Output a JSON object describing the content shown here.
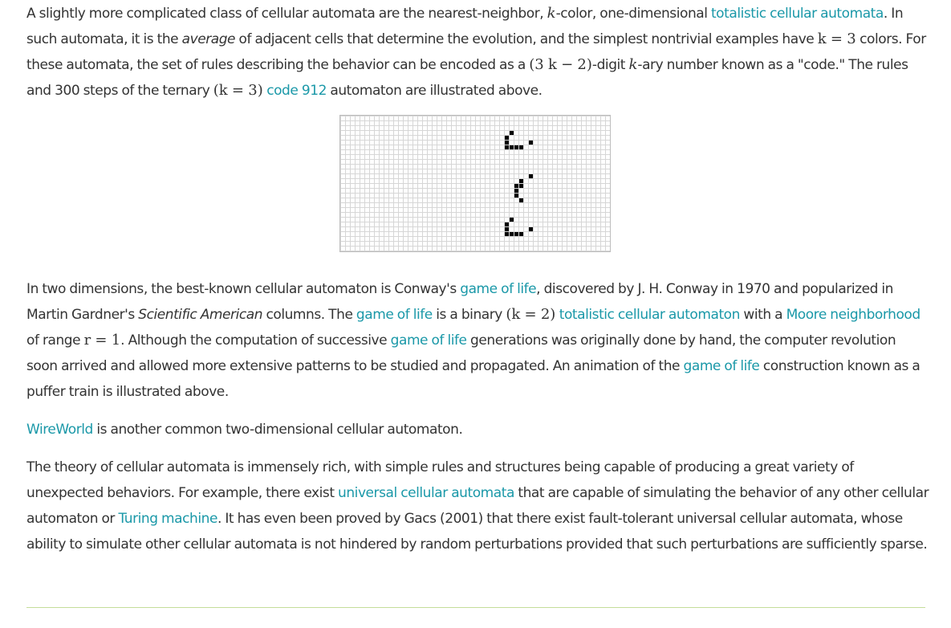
{
  "p1": {
    "t1": "A slightly more complicated class of cellular automata are the nearest-neighbor, ",
    "k1": "k",
    "t2": "-color, one-dimensional ",
    "link1": "totalistic cellular automata",
    "t3": ". In such automata, it is the ",
    "em1": "average",
    "t4": " of adjacent cells that determine the evolution, and the simplest nontrivial examples have ",
    "math1": "k = 3",
    "t5": " colors. For these automata, the set of rules describing the behavior can be encoded as a ",
    "math2": "(3 k − 2)",
    "t6": "-digit ",
    "k2": "k",
    "t7": "-ary number known as a \"code.\" The rules and 300 steps of the ternary ",
    "math3": "(k = 3)",
    "t8": " ",
    "link2": "code 912",
    "t9": " automaton are illustrated above."
  },
  "p2": {
    "t1": "In two dimensions, the best-known cellular automaton is Conway's ",
    "link1": "game of life",
    "t2": ", discovered by J. H. Conway in 1970 and popularized in Martin Gardner's ",
    "em1": "Scientific American",
    "t3": " columns. The ",
    "link2": "game of life",
    "t4": " is a binary ",
    "math1": "(k = 2)",
    "t5": " ",
    "link3": "totalistic cellular automaton",
    "t6": " with a ",
    "link4": "Moore neighborhood",
    "t7": " of range ",
    "math2": "r = 1",
    "t8": ". Although the computation of successive ",
    "link5": "game of life",
    "t9": " generations was originally done by hand, the computer revolution soon arrived and allowed more extensive patterns to be studied and propagated. An animation of the ",
    "link6": "game of life",
    "t10": " construction known as a puffer train is illustrated above."
  },
  "p3": {
    "link1": "WireWorld",
    "t1": " is another common two-dimensional cellular automaton."
  },
  "p4": {
    "t1": "The theory of cellular automata is immensely rich, with simple rules and structures being capable of producing a great variety of unexpected behaviors. For example, there exist ",
    "link1": "universal cellular automata",
    "t2": " that are capable of simulating the behavior of any other cellular automaton or ",
    "link2": "Turing machine",
    "t3": ". It has even been proved by Gacs (2001) that there exist fault-tolerant universal cellular automata, whose ability to simulate other cellular automata is not hindered by random perturbations provided that such perturbations are sufficiently sparse."
  },
  "figure": {
    "grid_cols": 56,
    "grid_rows": 28,
    "alive_color": "#000000",
    "alive_cells": [
      [
        35,
        3
      ],
      [
        34,
        4
      ],
      [
        34,
        5
      ],
      [
        34,
        6
      ],
      [
        35,
        6
      ],
      [
        36,
        6
      ],
      [
        37,
        6
      ],
      [
        39,
        5
      ],
      [
        39,
        12
      ],
      [
        37,
        13
      ],
      [
        36,
        14
      ],
      [
        37,
        14
      ],
      [
        36,
        15
      ],
      [
        36,
        16
      ],
      [
        37,
        17
      ],
      [
        35,
        21
      ],
      [
        34,
        22
      ],
      [
        34,
        23
      ],
      [
        34,
        24
      ],
      [
        35,
        24
      ],
      [
        36,
        24
      ],
      [
        37,
        24
      ],
      [
        39,
        23
      ]
    ]
  },
  "colors": {
    "link": "#1a98a8",
    "text": "#333333",
    "rule": "#c5dd9a"
  }
}
